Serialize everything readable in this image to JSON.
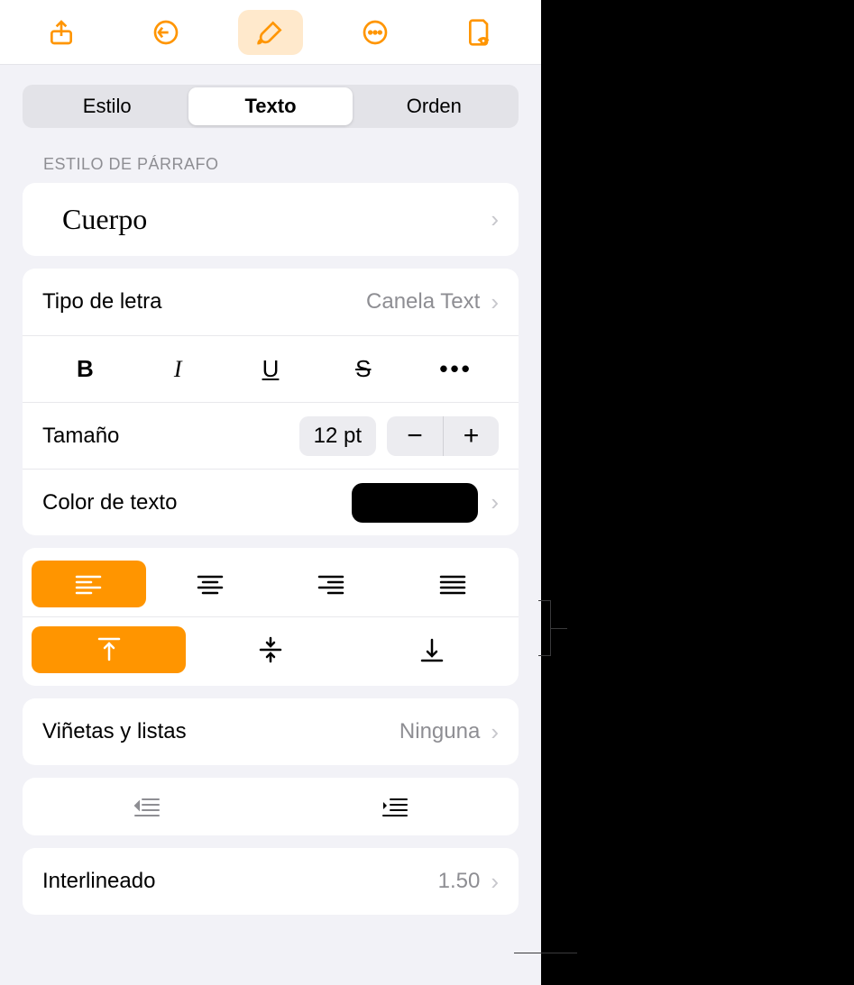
{
  "toolbar": {
    "share_icon": "share",
    "undo_icon": "undo",
    "format_icon": "brush",
    "more_icon": "more",
    "document_icon": "document"
  },
  "tabs": {
    "style": "Estilo",
    "text": "Texto",
    "order": "Orden"
  },
  "paragraph_style": {
    "section_label": "ESTILO DE PÁRRAFO",
    "current": "Cuerpo"
  },
  "font": {
    "label": "Tipo de letra",
    "value": "Canela Text",
    "bold": "B",
    "italic": "I",
    "underline": "U",
    "strike": "S",
    "more": "•••"
  },
  "size": {
    "label": "Tamaño",
    "value": "12 pt"
  },
  "text_color": {
    "label": "Color de texto",
    "value": "#000000"
  },
  "bullets": {
    "label": "Viñetas y listas",
    "value": "Ninguna"
  },
  "line_spacing": {
    "label": "Interlineado",
    "value": "1.50"
  }
}
